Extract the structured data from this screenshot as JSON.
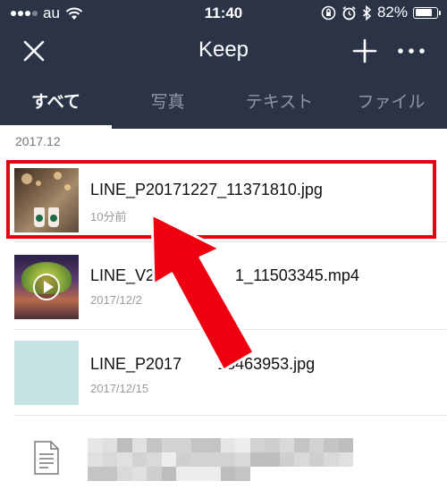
{
  "status_bar": {
    "carrier": "au",
    "time": "11:40",
    "battery_percent": "82%",
    "battery_level": 0.82
  },
  "navbar": {
    "title": "Keep",
    "icons": [
      "close-icon",
      "plus-icon",
      "more-icon"
    ]
  },
  "tabs": [
    {
      "label": "すべて",
      "active": true
    },
    {
      "label": "写真",
      "active": false
    },
    {
      "label": "テキスト",
      "active": false
    },
    {
      "label": "ファイル",
      "active": false
    }
  ],
  "section": {
    "date": "2017.12"
  },
  "files": [
    {
      "name": "LINE_P20171227_11371810.jpg",
      "meta": "10分前",
      "type": "photo",
      "highlighted": true
    },
    {
      "name": "LINE_V2",
      "name_tail": "1_11503345.mp4",
      "meta": "2017/12/2",
      "type": "video"
    },
    {
      "name": "LINE_P2017",
      "name_tail": "18463953.jpg",
      "meta": "2017/12/15",
      "type": "image"
    }
  ],
  "colors": {
    "header_bg": "#2b3447",
    "tab_inactive": "#8e97a8",
    "highlight": "#e60012",
    "arrow": "#ee0010"
  }
}
